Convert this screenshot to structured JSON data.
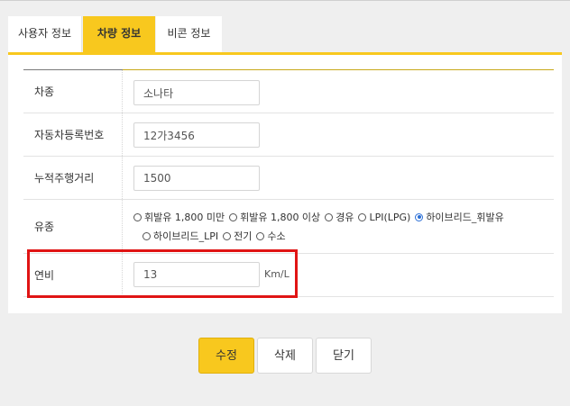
{
  "tabs": [
    {
      "label": "사용자 정보",
      "active": false
    },
    {
      "label": "차량 정보",
      "active": true
    },
    {
      "label": "비콘 정보",
      "active": false
    }
  ],
  "form": {
    "car_type": {
      "label": "차종",
      "value": "소나타"
    },
    "plate": {
      "label": "자동차등록번호",
      "value": "12가3456"
    },
    "mileage": {
      "label": "누적주행거리",
      "value": "1500"
    },
    "fuel": {
      "label": "유종",
      "options": [
        "휘발유 1,800 미만",
        "휘발유 1,800 이상",
        "경유",
        "LPI(LPG)",
        "하이브리드_휘발유",
        "하이브리드_LPI",
        "전기",
        "수소"
      ],
      "selected": "하이브리드_휘발유"
    },
    "efficiency": {
      "label": "연비",
      "value": "13",
      "unit": "Km/L"
    }
  },
  "buttons": {
    "edit": "수정",
    "delete": "삭제",
    "close": "닫기"
  },
  "colors": {
    "accent": "#f8c81e",
    "highlight": "#e01414",
    "radio_selected": "#2b6fd6"
  }
}
